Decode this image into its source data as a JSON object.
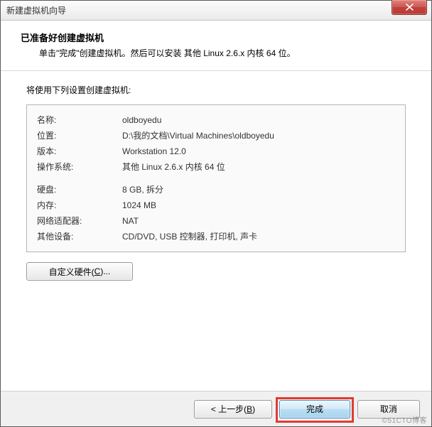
{
  "window": {
    "title": "新建虚拟机向导",
    "close_icon": "close"
  },
  "header": {
    "title": "已准备好创建虚拟机",
    "subtitle": "单击\"完成\"创建虚拟机。然后可以安装 其他 Linux 2.6.x 内核 64 位。"
  },
  "body": {
    "intro": "将使用下列设置创建虚拟机:",
    "rows_a": [
      {
        "label": "名称:",
        "value": "oldboyedu"
      },
      {
        "label": "位置:",
        "value": "D:\\我的文档\\Virtual Machines\\oldboyedu"
      },
      {
        "label": "版本:",
        "value": "Workstation 12.0"
      },
      {
        "label": "操作系统:",
        "value": "其他 Linux 2.6.x 内核 64 位"
      }
    ],
    "rows_b": [
      {
        "label": "硬盘:",
        "value": "8 GB, 拆分"
      },
      {
        "label": "内存:",
        "value": "1024 MB"
      },
      {
        "label": "网络适配器:",
        "value": "NAT"
      },
      {
        "label": "其他设备:",
        "value": "CD/DVD, USB 控制器, 打印机, 声卡"
      }
    ],
    "customize_label_pre": "自定义硬件(",
    "customize_key": "C",
    "customize_label_post": ")..."
  },
  "footer": {
    "back_pre": "< 上一步(",
    "back_key": "B",
    "back_post": ")",
    "finish": "完成",
    "cancel": "取消"
  },
  "watermark": "©51CTO博客"
}
